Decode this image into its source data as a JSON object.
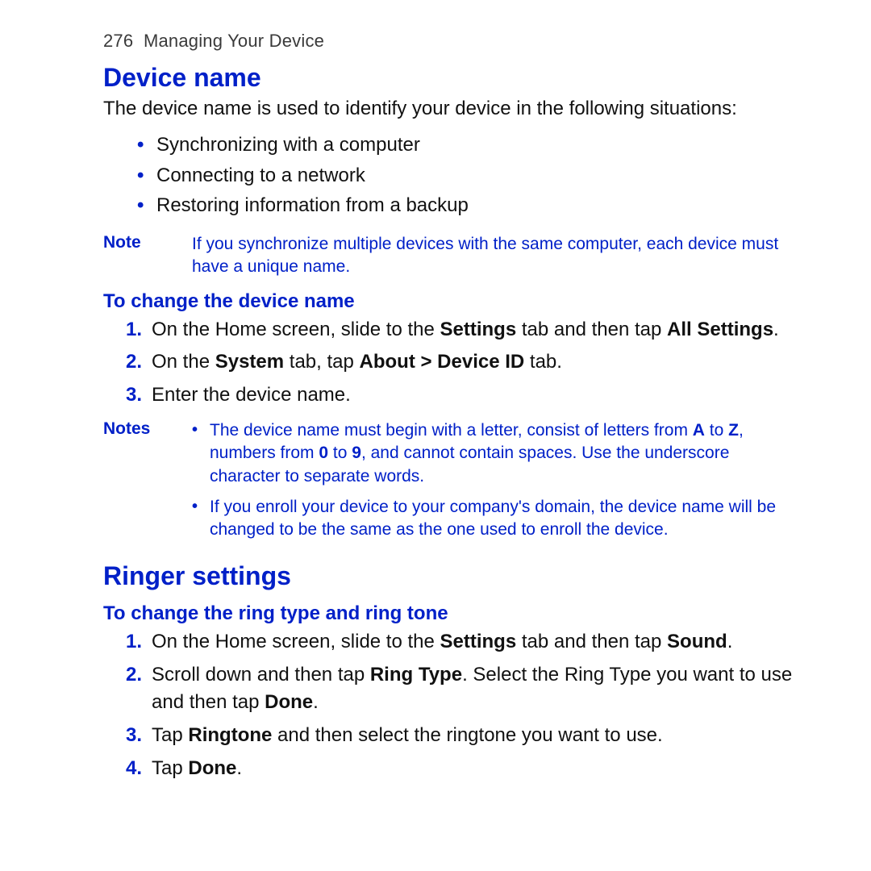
{
  "running_head": {
    "page_number": "276",
    "chapter": "Managing Your Device"
  },
  "sections": [
    {
      "title": "Device name",
      "intro": "The device name is used to identify your device in the following situations:",
      "bullets": [
        "Synchronizing with a computer",
        "Connecting to a network",
        "Restoring information from a backup"
      ],
      "note": {
        "label": "Note",
        "text_parts": [
          "If you synchronize multiple devices with the same computer, each device must have a unique name."
        ]
      },
      "subs": [
        {
          "heading": "To change the device name",
          "steps": [
            {
              "runs": [
                {
                  "t": "On the Home screen, slide to the "
                },
                {
                  "t": "Settings",
                  "b": true
                },
                {
                  "t": " tab and then tap "
                },
                {
                  "t": "All Settings",
                  "b": true
                },
                {
                  "t": "."
                }
              ]
            },
            {
              "runs": [
                {
                  "t": "On the "
                },
                {
                  "t": "System",
                  "b": true
                },
                {
                  "t": " tab, tap "
                },
                {
                  "t": "About > Device ID",
                  "b": true
                },
                {
                  "t": " tab."
                }
              ]
            },
            {
              "runs": [
                {
                  "t": "Enter the device name."
                }
              ]
            }
          ],
          "notes": {
            "label": "Notes",
            "items": [
              {
                "runs": [
                  {
                    "t": "The device name must begin with a letter, consist of letters from "
                  },
                  {
                    "t": "A",
                    "b": true
                  },
                  {
                    "t": " to "
                  },
                  {
                    "t": "Z",
                    "b": true
                  },
                  {
                    "t": ", numbers from "
                  },
                  {
                    "t": "0",
                    "b": true
                  },
                  {
                    "t": " to "
                  },
                  {
                    "t": "9",
                    "b": true
                  },
                  {
                    "t": ", and cannot contain spaces. Use the underscore character to separate words."
                  }
                ]
              },
              {
                "runs": [
                  {
                    "t": "If you enroll your device to your company's domain, the device name will be changed to be the same as the one used to enroll the device."
                  }
                ]
              }
            ]
          }
        }
      ]
    },
    {
      "title": "Ringer settings",
      "subs": [
        {
          "heading": "To change the ring type and ring tone",
          "steps": [
            {
              "runs": [
                {
                  "t": "On the Home screen, slide to the "
                },
                {
                  "t": "Settings",
                  "b": true
                },
                {
                  "t": " tab and then tap "
                },
                {
                  "t": "Sound",
                  "b": true
                },
                {
                  "t": "."
                }
              ]
            },
            {
              "runs": [
                {
                  "t": "Scroll down and then tap "
                },
                {
                  "t": "Ring Type",
                  "b": true
                },
                {
                  "t": ". Select the Ring Type you want to use and then tap "
                },
                {
                  "t": "Done",
                  "b": true
                },
                {
                  "t": "."
                }
              ]
            },
            {
              "runs": [
                {
                  "t": "Tap "
                },
                {
                  "t": "Ringtone",
                  "b": true
                },
                {
                  "t": " and then select the ringtone you want to use."
                }
              ]
            },
            {
              "runs": [
                {
                  "t": "Tap "
                },
                {
                  "t": "Done",
                  "b": true
                },
                {
                  "t": "."
                }
              ]
            }
          ]
        }
      ]
    }
  ]
}
